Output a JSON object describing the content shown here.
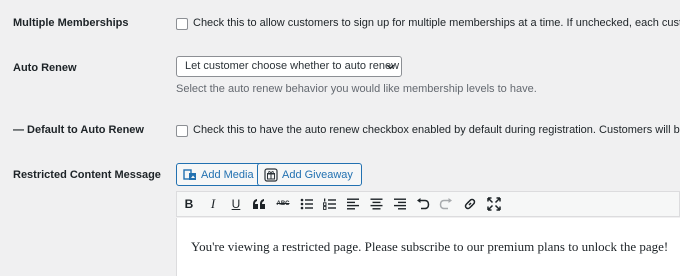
{
  "rows": {
    "multiple_memberships": {
      "label": "Multiple Memberships",
      "checkbox_text": "Check this to allow customers to sign up for multiple memberships at a time. If unchecked, each customer"
    },
    "auto_renew": {
      "label": "Auto Renew",
      "select_value": "Let customer choose whether to auto renew",
      "description": "Select the auto renew behavior you would like membership levels to have."
    },
    "default_auto_renew": {
      "label": "— Default to Auto Renew",
      "checkbox_text": "Check this to have the auto renew checkbox enabled by default during registration. Customers will be able"
    },
    "restricted_content": {
      "label": "Restricted Content Message",
      "add_media_label": "Add Media",
      "add_giveaway_label": "Add Giveaway",
      "toolbar": [
        "bold",
        "italic",
        "underline",
        "blockquote",
        "strikethrough",
        "bullet-list",
        "numbered-list",
        "align-left",
        "align-center",
        "align-right",
        "undo",
        "redo",
        "link",
        "fullscreen"
      ],
      "toolbar_text": {
        "bold": "B",
        "italic": "I",
        "underline": "U",
        "strikethrough": "ABC"
      },
      "editor_text": "You're viewing a restricted page. Please subscribe to our premium plans to unlock the page!"
    }
  },
  "colors": {
    "background": "#f0f0f1",
    "accent": "#2271b1",
    "muted_text": "#646970"
  }
}
